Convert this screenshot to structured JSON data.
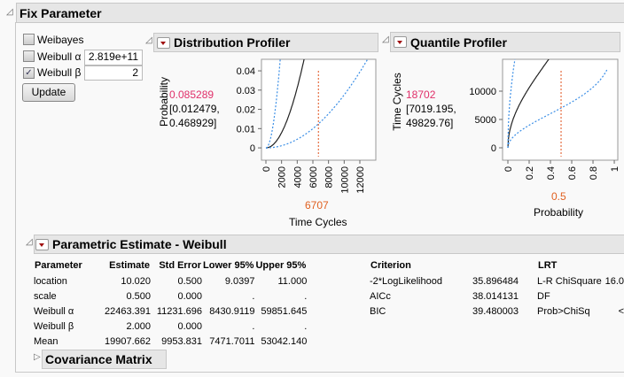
{
  "fix_parameter": {
    "title": "Fix Parameter",
    "options": [
      {
        "label": "Weibayes",
        "checked": false
      },
      {
        "label": "Weibull α",
        "checked": false,
        "value": "2.819e+11"
      },
      {
        "label": "Weibull β",
        "checked": true,
        "value": "2"
      }
    ],
    "update_label": "Update"
  },
  "distribution_profiler": {
    "title": "Distribution Profiler",
    "y_label": "Probability",
    "value": "0.085289",
    "ci_line1": "[0.012479,",
    "ci_line2": "0.468929]",
    "x_value": "6707",
    "x_label": "Time Cycles"
  },
  "quantile_profiler": {
    "title": "Quantile Profiler",
    "y_label": "Time Cycles",
    "value": "18702",
    "ci_line1": "[7019.195,",
    "ci_line2": "49829.76]",
    "x_value": "0.5",
    "x_label": "Probability"
  },
  "chart_data": [
    {
      "type": "line",
      "name": "distribution",
      "xlabel": "Time Cycles",
      "ylabel": "Probability",
      "xlim": [
        -566,
        14040
      ],
      "ylim": [
        -0.0064,
        0.046
      ],
      "xticks": [
        "0",
        "2000",
        "4000",
        "6000",
        "8000",
        "10000",
        "12000"
      ],
      "yticks": [
        "0",
        "0.01",
        "0.02",
        "0.03",
        "0.04"
      ],
      "series": [
        {
          "name": "estimate",
          "alpha": 22463.391,
          "beta": 2
        },
        {
          "name": "lower",
          "alpha": 59851.645,
          "beta": 2
        },
        {
          "name": "upper",
          "alpha": 8430.9119,
          "beta": 2
        }
      ],
      "crosshair_x": 6707
    },
    {
      "type": "line",
      "name": "quantile",
      "xlabel": "Probability",
      "ylabel": "Time Cycles",
      "xlim": [
        -0.05,
        1.033
      ],
      "ylim": [
        -2190,
        15625
      ],
      "xticks": [
        "0",
        "0.2",
        "0.4",
        "0.6",
        "0.8",
        "1"
      ],
      "yticks": [
        "0",
        "5000",
        "10000"
      ],
      "series": [
        {
          "name": "estimate",
          "alpha": 22463.391,
          "beta": 2
        },
        {
          "name": "lower",
          "alpha": 8430.9119,
          "beta": 2
        },
        {
          "name": "upper",
          "alpha": 59851.645,
          "beta": 2
        }
      ],
      "crosshair_x": 0.5
    }
  ],
  "parametric": {
    "title": "Parametric Estimate - Weibull",
    "headers": [
      "Parameter",
      "Estimate",
      "Std Error",
      "Lower 95%",
      "Upper 95%"
    ],
    "rows": [
      [
        "location",
        "10.020",
        "0.500",
        "9.0397",
        "11.000"
      ],
      [
        "scale",
        "0.500",
        "0.000",
        ".",
        "."
      ],
      [
        "Weibull α",
        "22463.391",
        "11231.696",
        "8430.9119",
        "59851.645"
      ],
      [
        "Weibull β",
        "2.000",
        "0.000",
        ".",
        "."
      ],
      [
        "Mean",
        "19907.662",
        "9953.831",
        "7471.7011",
        "53042.140"
      ]
    ],
    "criterion_header": "Criterion",
    "criteria": [
      [
        "-2*LogLikelihood",
        "35.896484"
      ],
      [
        "AICc",
        "38.014131"
      ],
      [
        "BIC",
        "39.480003"
      ]
    ],
    "lrt_header": "LRT",
    "lrt": [
      [
        "L-R ChiSquare",
        "16.0"
      ],
      [
        "DF",
        ""
      ],
      [
        "Prob>ChiSq",
        "<"
      ]
    ]
  },
  "covariance": {
    "title": "Covariance Matrix"
  }
}
